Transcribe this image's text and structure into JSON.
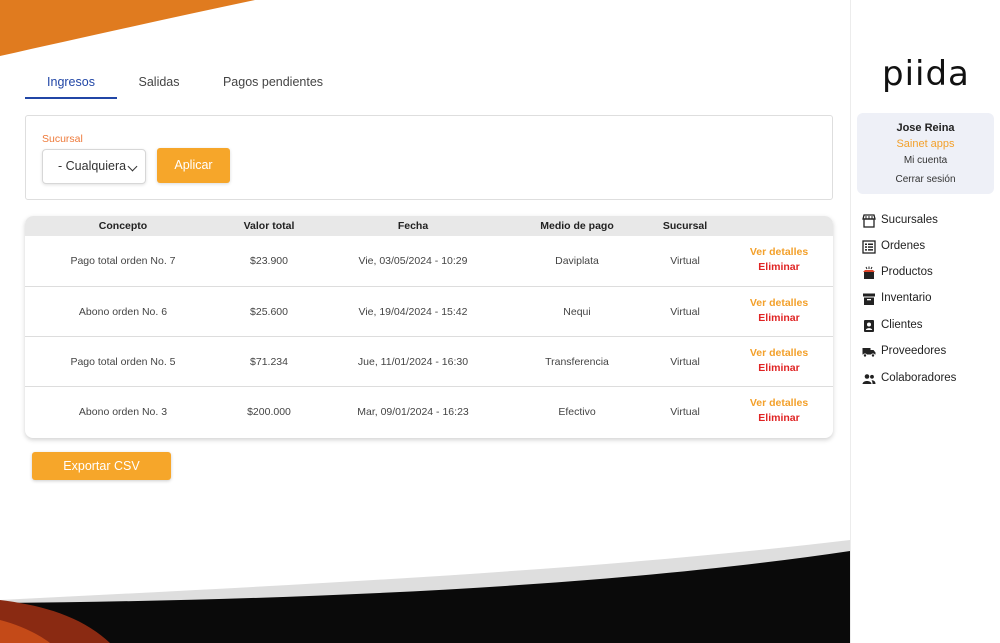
{
  "tabs": [
    {
      "label": "Ingresos",
      "active": true
    },
    {
      "label": "Salidas",
      "active": false
    },
    {
      "label": "Pagos pendientes",
      "active": false
    }
  ],
  "filter": {
    "label": "Sucursal",
    "select_value": "- Cualquiera",
    "apply_label": "Aplicar"
  },
  "table": {
    "headers": [
      "Concepto",
      "Valor total",
      "Fecha",
      "Medio de pago",
      "Sucursal"
    ],
    "rows": [
      {
        "concepto": "Pago total orden No. 7",
        "valor": "$23.900",
        "fecha": "Vie, 03/05/2024 - 10:29",
        "medio": "Daviplata",
        "sucursal": "Virtual",
        "ver": "Ver detalles",
        "eliminar": "Eliminar"
      },
      {
        "concepto": "Abono orden No. 6",
        "valor": "$25.600",
        "fecha": "Vie, 19/04/2024 - 15:42",
        "medio": "Nequi",
        "sucursal": "Virtual",
        "ver": "Ver detalles",
        "eliminar": "Eliminar"
      },
      {
        "concepto": "Pago total orden No. 5",
        "valor": "$71.234",
        "fecha": "Jue, 11/01/2024 - 16:30",
        "medio": "Transferencia",
        "sucursal": "Virtual",
        "ver": "Ver detalles",
        "eliminar": "Eliminar"
      },
      {
        "concepto": "Abono orden No. 3",
        "valor": "$200.000",
        "fecha": "Mar, 09/01/2024 - 16:23",
        "medio": "Efectivo",
        "sucursal": "Virtual",
        "ver": "Ver detalles",
        "eliminar": "Eliminar"
      }
    ]
  },
  "export_label": "Exportar CSV",
  "sidebar": {
    "logo": "piida",
    "user": {
      "name": "Jose Reina",
      "company": "Sainet apps",
      "account": "Mi cuenta",
      "logout": "Cerrar sesión"
    },
    "items": [
      {
        "label": "Sucursales",
        "icon": "store-icon"
      },
      {
        "label": "Ordenes",
        "icon": "list-icon"
      },
      {
        "label": "Productos",
        "icon": "product-box-icon"
      },
      {
        "label": "Inventario",
        "icon": "archive-icon"
      },
      {
        "label": "Clientes",
        "icon": "contact-card-icon"
      },
      {
        "label": "Proveedores",
        "icon": "truck-icon"
      },
      {
        "label": "Colaboradores",
        "icon": "people-icon"
      }
    ]
  },
  "colors": {
    "accent": "#f6a62a",
    "tab_active": "#2146a6",
    "danger": "#e02424",
    "label_orange": "#ee7a3a"
  }
}
